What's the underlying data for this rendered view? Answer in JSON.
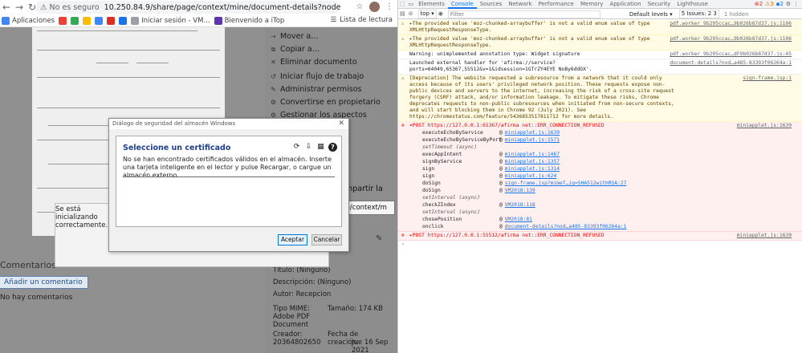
{
  "browser": {
    "address": {
      "security": "No es seguro",
      "url": "10.250.84.9/share/page/context/mine/document-details?nodeRef=workspace://Space..."
    },
    "bookmarks": [
      {
        "label": "Aplicaciones",
        "color": "#4285f4"
      },
      {
        "label": "",
        "color": "#ea4335"
      },
      {
        "label": "",
        "color": "#34a853"
      },
      {
        "label": "",
        "color": "#fbbc05"
      },
      {
        "label": "",
        "color": "#4285f4"
      },
      {
        "label": "",
        "color": "#d93025"
      },
      {
        "label": "",
        "color": "#1a73e8"
      },
      {
        "label": "Iniciar sesión - VM...",
        "color": "#9aa0a6"
      },
      {
        "label": "Bienvenido a iTop",
        "color": "#5e35b1"
      }
    ],
    "reading_list": "Lista de lectura"
  },
  "document": {
    "actions": [
      {
        "label": "Mover a...",
        "icon": "move-icon"
      },
      {
        "label": "Copiar a...",
        "icon": "copy-icon"
      },
      {
        "label": "Eliminar documento",
        "icon": "delete-icon"
      },
      {
        "label": "Iniciar flujo de trabajo",
        "icon": "workflow-icon"
      },
      {
        "label": "Administrar permisos",
        "icon": "permissions-icon"
      },
      {
        "label": "Convertirse en propietario",
        "icon": "owner-icon"
      },
      {
        "label": "Gestionar los aspectos",
        "icon": "aspects-icon"
      }
    ],
    "share_fragment": "mpartir la",
    "share_url": "ce/context/m",
    "comments_title": "Comentarios",
    "add_comment": "Añadir un comentario",
    "no_comments": "No hay comentarios",
    "title": "Título:  (Ninguno)",
    "description": "Descripción:  (Ninguno)",
    "author": "Autor:  Recepcion",
    "mime_label": "Tipo MIME:",
    "mime_value": "Adobe PDF Document",
    "size": "Tamaño:  174 KB",
    "creator_label": "Creador:",
    "creator_value": "20364802650",
    "created_label": "Fecha de creación:",
    "created_value": "Jue 16 Sep 2021 11:38:18",
    "loading_text": "Se está inicializando correctamente."
  },
  "cert_dialog": {
    "window_title": "Diálogo de seguridad del almacén Windows",
    "heading": "Seleccione un certificado",
    "message": "No se han encontrado certificados válidos en el almacén. Inserte una tarjeta inteligente en el lector y pulse Recargar, o cargue un almacén externo.",
    "accept": "Aceptar",
    "cancel": "Cancelar"
  },
  "devtools": {
    "tabs": [
      "Elements",
      "Console",
      "Sources",
      "Network",
      "Performance",
      "Memory",
      "Application",
      "Security",
      "Lighthouse"
    ],
    "active_tab": "Console",
    "badges": {
      "errors": "2",
      "warnings": "3",
      "info": "2"
    },
    "context": "top",
    "filter_placeholder": "Filter",
    "levels": "Default levels",
    "issues": "5 Issues: 2 3",
    "hidden": "1 hidden",
    "messages": [
      {
        "type": "warn",
        "text": "The provided value 'moz-chunked-arraybuffer' is not a valid enum value of type XMLHttpRequestResponseType.",
        "source": "pdf.worker 9b295ccac…9b026b87d37.js:1106"
      },
      {
        "type": "warn",
        "text": "The provided value 'moz-chunked-arraybuffer' is not a valid enum value of type XMLHttpRequestResponseType.",
        "source": "pdf.worker 9b295ccac…9b026b87d37.js:1106"
      },
      {
        "type": "info",
        "text": "Warning: unimplemented annotation type: Widget signature",
        "source": "pdf.worker 9b295ccac…dF9b026b87d37.js:45"
      },
      {
        "type": "info",
        "text": "Launched external handler for 'afirma://service?ports=64049,65367,55512&v=1&idsession=1GTrZY4EYE NoBy6ddOX'.",
        "source": "document-details?nod…a485-83393f06264a:1"
      },
      {
        "type": "warn",
        "text": "[Deprecation] The website requested a subresource from a network that it could only access because of its users' privileged network position. These requests expose non-public devices and servers to the internet, increasing the risk of a cross-site request forgery (CSRF) attack, and/or information leakage. To mitigate these risks, Chrome deprecates requests to non-public subresources when initiated from non-secure contexts, and will start blocking them in Chrome 92 (July 2021). See https://chromestatus.com/feature/5436853517811712 for more details.",
        "source": "sign-frame.jsp:1"
      },
      {
        "type": "err",
        "text": "POST https://127.0.0.1:65367/afirma net::ERR_CONNECTION_REFUSED",
        "source": "miniapplet.js:1639"
      }
    ],
    "stack": [
      {
        "fn": "executeEchoByService",
        "loc": "miniapplet.js:1639"
      },
      {
        "fn": "executeEchoByServiceByPort",
        "loc": "miniapplet.js:1571"
      },
      {
        "async": "setTimeout (async)"
      },
      {
        "fn": "execAppIntent",
        "loc": "miniapplet.js:1467"
      },
      {
        "fn": "signByService",
        "loc": "miniapplet.js:1357"
      },
      {
        "fn": "sign",
        "loc": "miniapplet.js:1314"
      },
      {
        "fn": "sign",
        "loc": "miniapplet.js:624"
      },
      {
        "fn": "doSign",
        "loc": "sign-frame.jsp?mimeT…ig=SHA512withRSA:27"
      },
      {
        "fn": "doSign",
        "loc": "VM2018:139"
      },
      {
        "async": "setInterval (async)"
      },
      {
        "fn": "checkZIndex",
        "loc": "VM2018:118"
      },
      {
        "async": "setInterval (async)"
      },
      {
        "fn": "chosePosition",
        "loc": "VM2018:81"
      },
      {
        "fn": "onclick",
        "loc": "document-details?nod…a485-83393f06264a:1"
      }
    ],
    "last_error": {
      "text": "POST https://127.0.0.1:55512/afirma net::ERR_CONNECTION_REFUSED",
      "source": "miniapplet.js:1639"
    }
  }
}
